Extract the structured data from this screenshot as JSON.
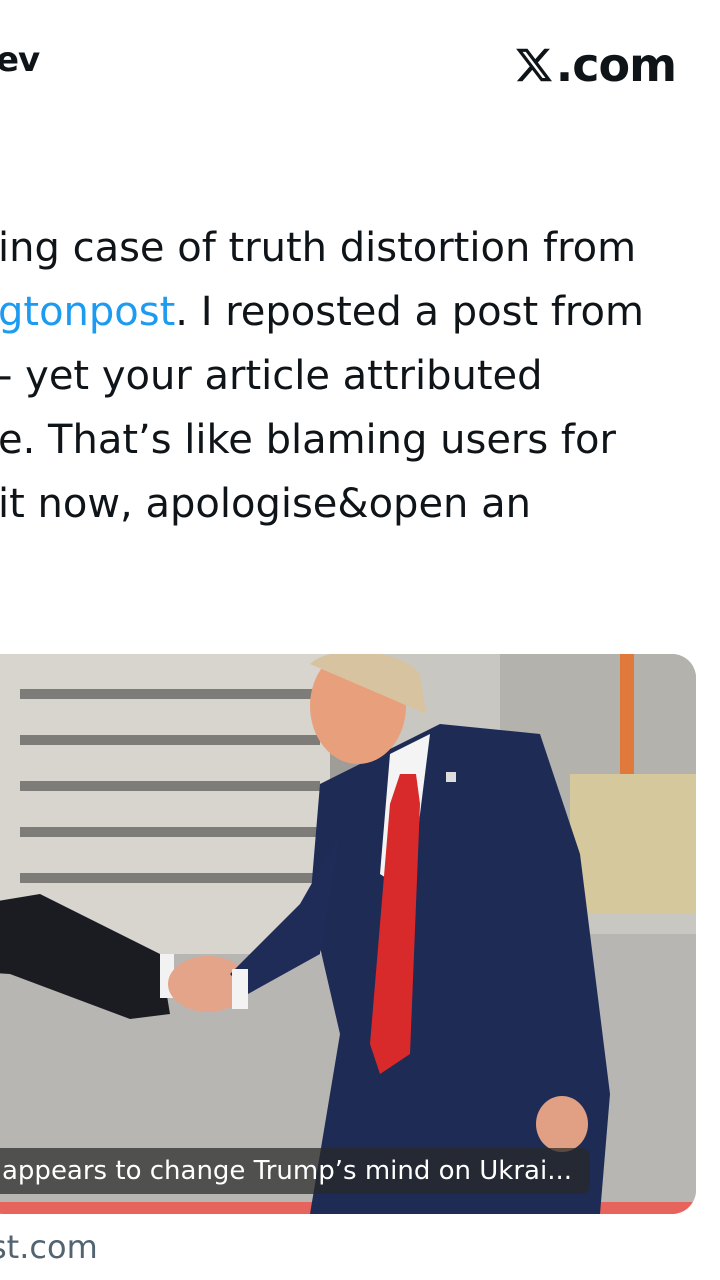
{
  "header": {
    "author_name_fragment": "ev",
    "brand_domain": ".com",
    "brand_logo_icon": "x-logo-icon"
  },
  "tweet": {
    "lines": [
      {
        "pre": "ing case of truth distortion from",
        "mention": "",
        "post": ""
      },
      {
        "pre": "",
        "mention": "gtonpost",
        "post": ". I reposted a post from"
      },
      {
        "pre": " - yet your article attributed",
        "mention": "",
        "post": ""
      },
      {
        "pre": "e. That’s like blaming users for",
        "mention": "",
        "post": ""
      },
      {
        "pre": "it now, apologise&open an",
        "mention": "",
        "post": ""
      }
    ],
    "mention_color": "#1d9bf0"
  },
  "link_card": {
    "caption": "appears to change Trump’s mind on Ukrai...",
    "domain_fragment": "st.com",
    "image_subject": "photo-handshake"
  }
}
